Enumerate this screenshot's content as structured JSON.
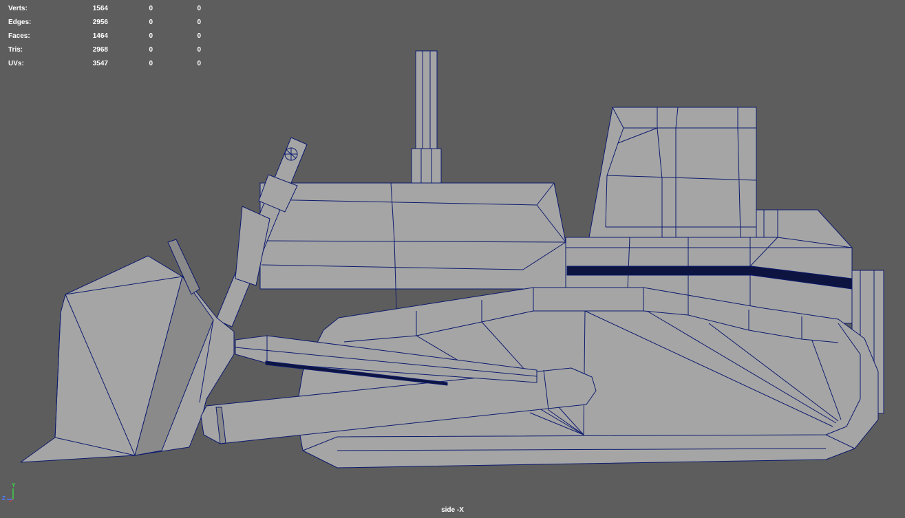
{
  "hud": {
    "rows": [
      {
        "label": "Verts:",
        "values": [
          "1564",
          "0",
          "0"
        ]
      },
      {
        "label": "Edges:",
        "values": [
          "2956",
          "0",
          "0"
        ]
      },
      {
        "label": "Faces:",
        "values": [
          "1464",
          "0",
          "0"
        ]
      },
      {
        "label": "Tris:",
        "values": [
          "2968",
          "0",
          "0"
        ]
      },
      {
        "label": "UVs:",
        "values": [
          "3547",
          "0",
          "0"
        ]
      }
    ]
  },
  "camera": {
    "label": "side -X"
  },
  "axis": {
    "y": "Y",
    "z": "Z",
    "y_color": "#3fd24a",
    "z_color": "#4f7bff"
  },
  "colors": {
    "background": "#5d5d5d",
    "mesh_fill": "#a5a5a5",
    "wire": "#0c1a6e",
    "hud_text": "#ffffff"
  }
}
